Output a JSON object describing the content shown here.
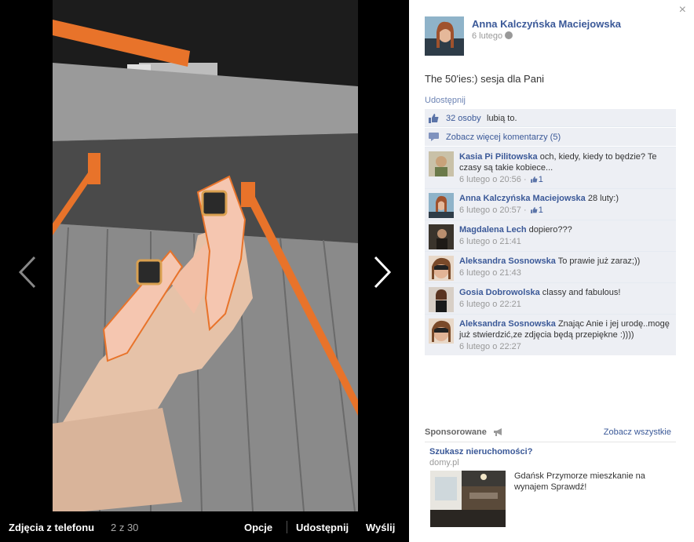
{
  "viewer": {
    "album_title": "Zdjęcia z telefonu",
    "photo_count": "2 z 30",
    "options_label": "Opcje",
    "share_label": "Udostępnij",
    "send_label": "Wyślij",
    "prev_icon": "chevron-left-icon",
    "next_icon": "chevron-right-icon"
  },
  "post": {
    "author": "Anna Kalczyńska Maciejowska",
    "date": "6 lutego",
    "privacy_icon": "globe-icon",
    "caption": "The 50'ies:) sesja dla Pani",
    "share_link": "Udostępnij",
    "likes_count": "32 osoby",
    "likes_text": "lubią to.",
    "more_comments": "Zobacz więcej komentarzy (5)",
    "close": "×"
  },
  "comments": [
    {
      "author": "Kasia Pi Pilitowska",
      "text": "och, kiedy, kiedy to będzie? Te czasy są takie kobiece...",
      "time": "6 lutego o 20:56",
      "likes": "1"
    },
    {
      "author": "Anna Kalczyńska Maciejowska",
      "text": "28 luty:)",
      "time": "6 lutego o 20:57",
      "likes": "1"
    },
    {
      "author": "Magdalena Lech",
      "text": "dopiero???",
      "time": "6 lutego o 21:41"
    },
    {
      "author": "Aleksandra Sosnowska",
      "text": "To prawie już zaraz;))",
      "time": "6 lutego o 21:43"
    },
    {
      "author": "Gosia Dobrowolska",
      "text": "classy and fabulous!",
      "time": "6 lutego o 22:21"
    },
    {
      "author": "Aleksandra Sosnowska",
      "text": "Znając Anie i jej urodę..mogę już stwierdzić,ze zdjęcia będą przepiękne :))))",
      "time": "6 lutego o 22:27"
    }
  ],
  "sponsored": {
    "label": "Sponsorowane",
    "see_all": "Zobacz wszystkie",
    "ad_title": "Szukasz nieruchomości?",
    "ad_domain": "domy.pl",
    "ad_text": "Gdańsk Przymorze mieszkanie na wynajem Sprawdź!"
  },
  "colors": {
    "link": "#3b5998",
    "panel_bg": "#edeff4",
    "viewer_bg": "#000000",
    "shoe_orange": "#e8732a"
  }
}
